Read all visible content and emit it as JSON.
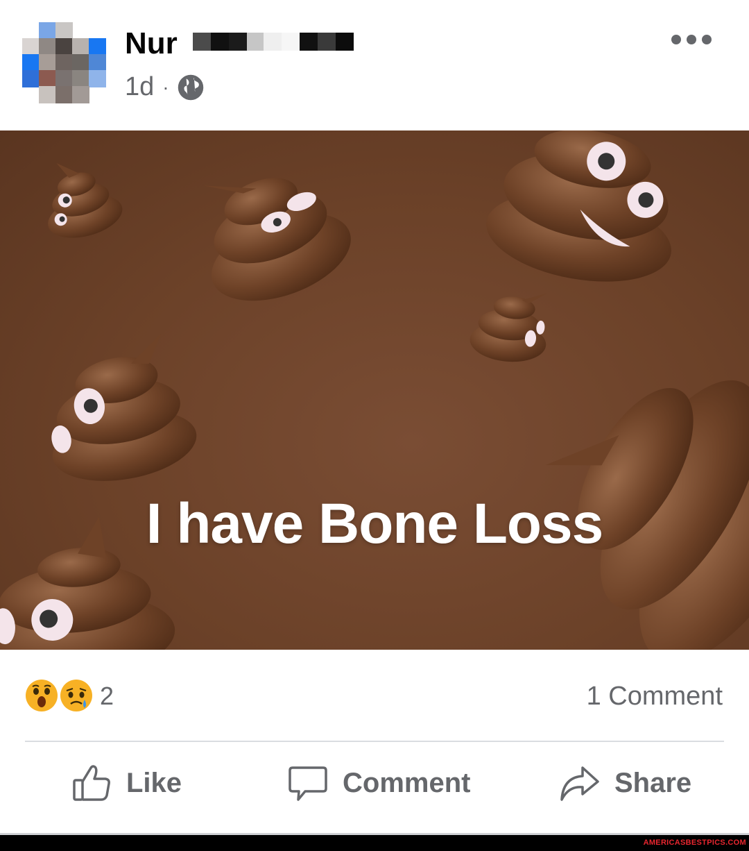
{
  "post": {
    "author": "Nur",
    "time": "1d",
    "separator": "·",
    "visibility_icon": "globe-icon",
    "more_icon": "more-options-icon"
  },
  "media": {
    "caption": "I have Bone Loss",
    "background_color": "#6b4128"
  },
  "stats": {
    "reactions": [
      "wow-reaction",
      "sad-reaction"
    ],
    "reaction_count": "2",
    "comment_count": "1 Comment"
  },
  "actions": {
    "like_label": "Like",
    "comment_label": "Comment",
    "share_label": "Share"
  },
  "footer": {
    "watermark": "AMERICASBESTPICS.COM"
  }
}
